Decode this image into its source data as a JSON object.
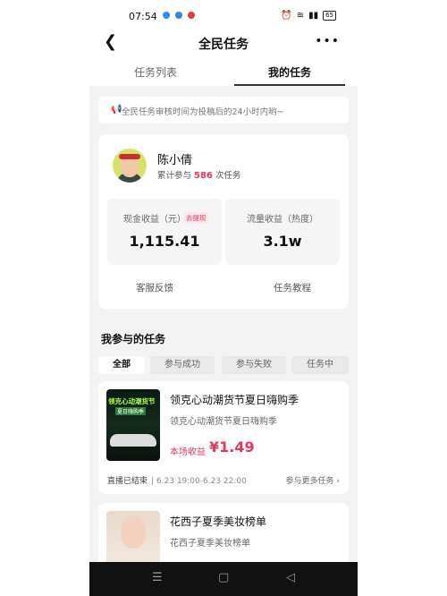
{
  "status_bar": {
    "time": "07:54",
    "battery": "65"
  },
  "header": {
    "title": "全民任务"
  },
  "tabs": [
    {
      "label": "任务列表"
    },
    {
      "label": "我的任务"
    }
  ],
  "notice": {
    "text": "全民任务审核时间为投稿后的24小时内哟~"
  },
  "profile": {
    "name": "陈小倩",
    "count_prefix": "累计参与",
    "count": "586",
    "count_suffix": "次任务",
    "cash_label": "现金收益（元）",
    "withdraw_label": "去提现",
    "cash_value": "1,115.41",
    "traffic_label": "流量收益（热度）",
    "traffic_value": "3.1w",
    "service_link": "客服反馈",
    "tutorial_link": "任务教程"
  },
  "section_title": "我参与的任务",
  "filters": [
    {
      "label": "全部"
    },
    {
      "label": "参与成功"
    },
    {
      "label": "参与失败"
    },
    {
      "label": "任务中"
    }
  ],
  "tasks": [
    {
      "title": "领克心动潮货节夏日嗨购季",
      "subtitle": "领克心动潮货节夏日嗨购季",
      "thumb_title": "领克心动潮货节",
      "thumb_sub": "夏日嗨购季",
      "earn_label": "本场收益",
      "earn_value": "¥1.49",
      "status": "直播已结束",
      "time": "6.23 19:00-6.23 22:00",
      "more": "参与更多任务"
    },
    {
      "title": "花西子夏季美妆榜单",
      "subtitle": "花西子夏季美妆榜单"
    }
  ],
  "colors": {
    "accent": "#e8345a",
    "background": "#f3f3f3"
  }
}
